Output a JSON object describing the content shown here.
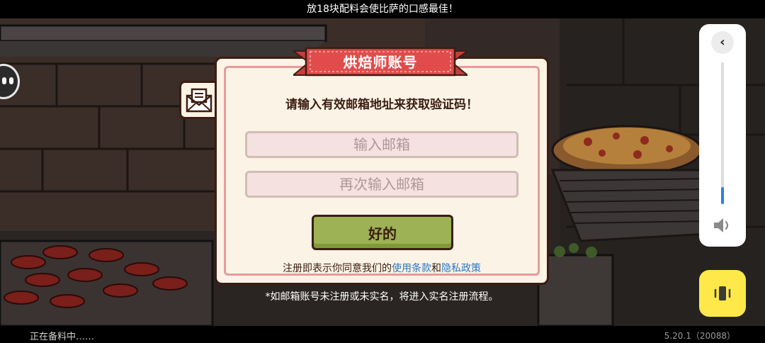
{
  "top_tip": "放18块配料会使比萨的口感最佳！",
  "dialog": {
    "title": "烘焙师账号",
    "instruction": "请输入有效邮箱地址来获取验证码！",
    "email_placeholder": "输入邮箱",
    "confirm_email_placeholder": "再次输入邮箱",
    "ok_label": "好的",
    "terms_prefix": "注册即表示你同意我们的",
    "terms_link": "使用条款",
    "terms_and": "和",
    "privacy_link": "隐私政策"
  },
  "note": "*如邮箱账号未注册或未实名，将进入实名注册流程。",
  "footer": {
    "loading": "正在备料中……",
    "version": "5.20.1（20088）"
  },
  "volume": {
    "level": 0.12
  },
  "colors": {
    "ribbon": "#e24b4b",
    "button": "#9cb255",
    "link": "#2b78c6",
    "vibrate": "#ffe94a"
  },
  "icons": {
    "mail": "envelope-icon",
    "collapse": "chevron-left-icon",
    "speaker": "speaker-icon",
    "vibrate": "vibrate-icon"
  }
}
